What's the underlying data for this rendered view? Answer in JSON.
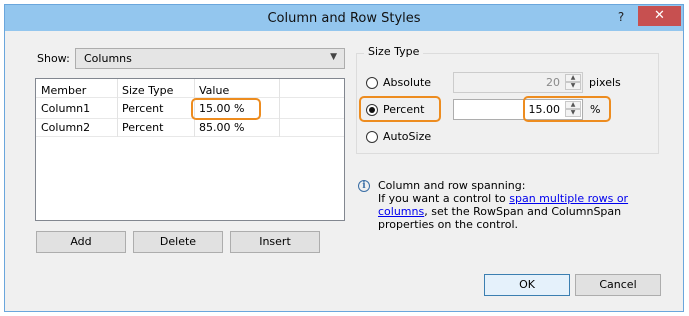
{
  "window": {
    "title": "Column and Row Styles",
    "help": "?",
    "close": "✕"
  },
  "show": {
    "label": "Show:",
    "value": "Columns"
  },
  "grid": {
    "headers": [
      "Member",
      "Size Type",
      "Value"
    ],
    "rows": [
      [
        "Column1",
        "Percent",
        "15.00 %"
      ],
      [
        "Column2",
        "Percent",
        "85.00 %"
      ]
    ]
  },
  "buttons": {
    "add": "Add",
    "delete": "Delete",
    "insert": "Insert",
    "ok": "OK",
    "cancel": "Cancel"
  },
  "size_type": {
    "title": "Size Type",
    "absolute": {
      "label": "Absolute",
      "value": "20",
      "unit": "pixels"
    },
    "percent": {
      "label": "Percent",
      "value": "15.00",
      "unit": "%"
    },
    "autosize": {
      "label": "AutoSize"
    },
    "selected": "Percent"
  },
  "note": {
    "heading": "Column and row spanning:",
    "line_start": "If you want a control to ",
    "link": "span multiple rows or columns",
    "line_end": ", set the RowSpan and ColumnSpan properties on the control."
  },
  "colors": {
    "highlight": "#ed8c1f",
    "titlebar": "#93c6ee",
    "close": "#c75050"
  }
}
